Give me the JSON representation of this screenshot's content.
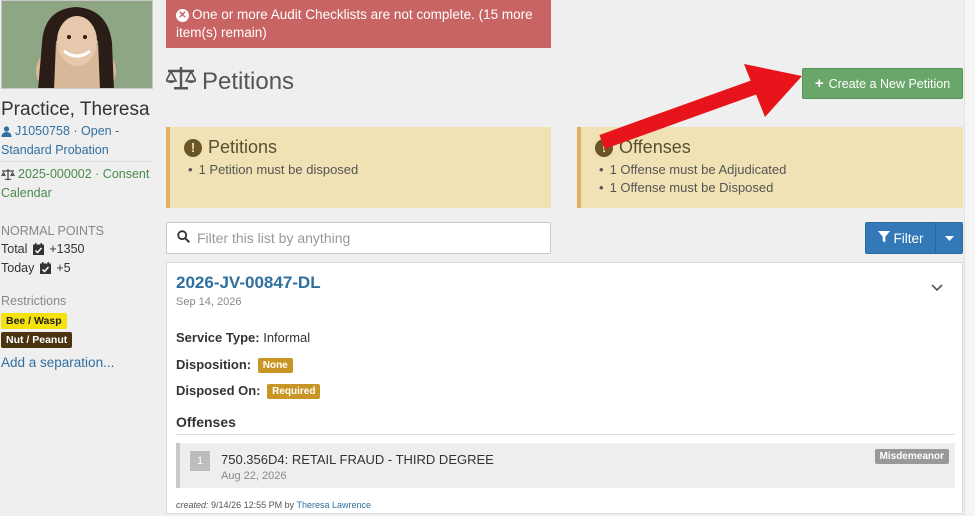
{
  "alert": {
    "icon": "error-circle-icon",
    "text": "One or more Audit Checklists are not complete. (15 more item(s) remain)"
  },
  "profile": {
    "name": "Practice, Theresa",
    "id_line": "J1050758 · Open - Standard Probation",
    "case_line": "2025-000002 · Consent Calendar",
    "points_label": "NORMAL POINTS",
    "total_label": "Total",
    "total_value": "+1350",
    "today_label": "Today",
    "today_value": "+5",
    "restrictions_label": "Restrictions",
    "restrictions": [
      {
        "label": "Bee / Wasp",
        "bg": "#f5e10c",
        "color": "#222"
      },
      {
        "label": "Nut / Peanut",
        "bg": "#4a3410",
        "color": "#fff"
      }
    ],
    "add_separation": "Add a separation..."
  },
  "page": {
    "title": "Petitions",
    "create_button": "Create a New Petition"
  },
  "warnings": {
    "petitions": {
      "title": "Petitions",
      "items": [
        "1 Petition must be disposed"
      ]
    },
    "offenses": {
      "title": "Offenses",
      "items": [
        "1 Offense must be Adjudicated",
        "1 Offense must be Disposed"
      ]
    }
  },
  "search": {
    "placeholder": "Filter this list by anything"
  },
  "filter": {
    "label": "Filter"
  },
  "petition": {
    "number": "2026-JV-00847-DL",
    "date": "Sep 14, 2026",
    "service_type_label": "Service Type:",
    "service_type": "Informal",
    "disposition_label": "Disposition:",
    "disposition": "None",
    "disposed_on_label": "Disposed On:",
    "disposed_on": "Required",
    "offenses_title": "Offenses",
    "offense": {
      "number": "1",
      "description": "750.356D4: RETAIL FRAUD - THIRD DEGREE",
      "date": "Aug 22, 2026",
      "class": "Misdemeanor"
    },
    "created_label": "created:",
    "created_text": "9/14/26 12:55 PM by",
    "created_by": "Theresa Lawrence"
  },
  "colors": {
    "link": "#2f6f9f",
    "alert_bg": "#c96464",
    "warning_bg": "#f0e2b4",
    "primary": "#3379b7",
    "success": "#6aa66a",
    "annotation_arrow": "#e8141b"
  }
}
